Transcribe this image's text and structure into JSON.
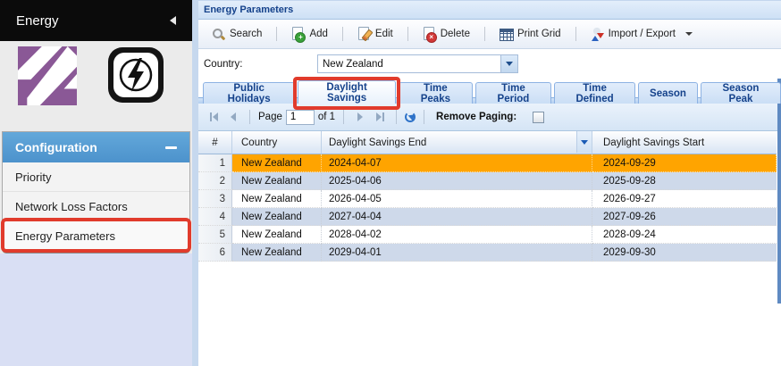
{
  "annotation_color": "#e13b2c",
  "accent_colors": {
    "selected_row": "#ffa400",
    "alt_row": "#ced9ea",
    "header_blue": "#4c92cc",
    "tab_text": "#15428b"
  },
  "sidebar": {
    "title": "Energy",
    "logos": [
      "energy-logo",
      "lightning-bolt-logo"
    ],
    "accordion": {
      "header": "Configuration",
      "items": [
        {
          "label": "Priority",
          "highlighted": false
        },
        {
          "label": "Network Loss Factors",
          "highlighted": false
        },
        {
          "label": "Energy Parameters",
          "highlighted": true
        }
      ]
    }
  },
  "main": {
    "title": "Energy Parameters",
    "toolbar": {
      "buttons": [
        {
          "label": "Search",
          "icon": "search",
          "has_menu": false
        },
        {
          "label": "Add",
          "icon": "add",
          "has_menu": false
        },
        {
          "label": "Edit",
          "icon": "edit",
          "has_menu": false
        },
        {
          "label": "Delete",
          "icon": "delete",
          "has_menu": false
        },
        {
          "label": "Print Grid",
          "icon": "print-grid",
          "has_menu": false
        },
        {
          "label": "Import / Export",
          "icon": "import-export",
          "has_menu": true
        }
      ]
    },
    "country": {
      "label": "Country:",
      "value": "New Zealand"
    },
    "tabs": [
      {
        "label": "Public Holidays",
        "selected": false,
        "annotated": false
      },
      {
        "label": "Daylight Savings",
        "selected": true,
        "annotated": true
      },
      {
        "label": "Time Peaks",
        "selected": false,
        "annotated": false
      },
      {
        "label": "Time Period",
        "selected": false,
        "annotated": false
      },
      {
        "label": "Time Defined",
        "selected": false,
        "annotated": false
      },
      {
        "label": "Season",
        "selected": false,
        "annotated": false
      },
      {
        "label": "Season Peak",
        "selected": false,
        "annotated": false
      }
    ],
    "paging": {
      "page_label": "Page",
      "page_value": "1",
      "of_label": "of 1",
      "remove_paging_label": "Remove Paging:",
      "remove_paging_checked": false
    },
    "grid": {
      "columns": [
        "#",
        "Country",
        "Daylight Savings End",
        "Daylight Savings Start"
      ],
      "rows": [
        {
          "num": 1,
          "country": "New Zealand",
          "end": "2024-04-07",
          "start": "2024-09-29",
          "selected": true
        },
        {
          "num": 2,
          "country": "New Zealand",
          "end": "2025-04-06",
          "start": "2025-09-28",
          "selected": false
        },
        {
          "num": 3,
          "country": "New Zealand",
          "end": "2026-04-05",
          "start": "2026-09-27",
          "selected": false
        },
        {
          "num": 4,
          "country": "New Zealand",
          "end": "2027-04-04",
          "start": "2027-09-26",
          "selected": false
        },
        {
          "num": 5,
          "country": "New Zealand",
          "end": "2028-04-02",
          "start": "2028-09-24",
          "selected": false
        },
        {
          "num": 6,
          "country": "New Zealand",
          "end": "2029-04-01",
          "start": "2029-09-30",
          "selected": false
        }
      ]
    }
  }
}
